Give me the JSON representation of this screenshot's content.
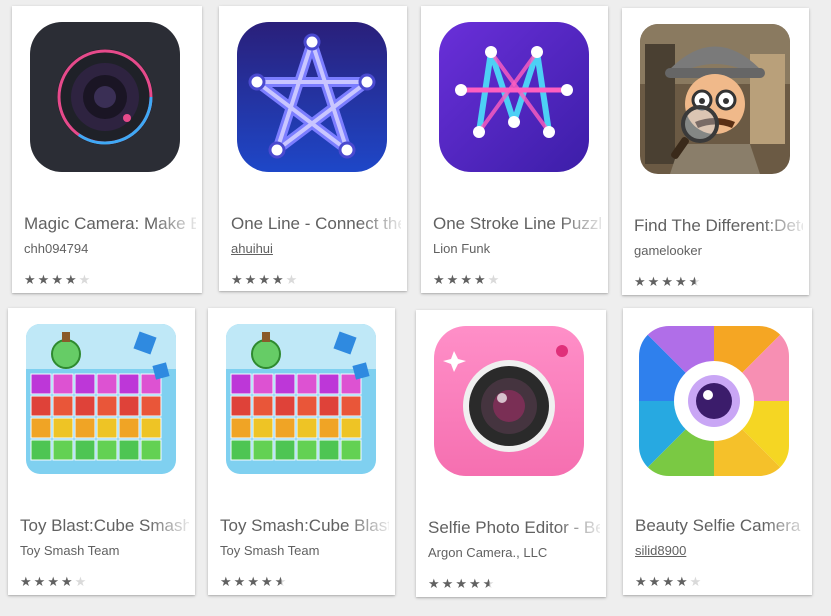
{
  "apps": [
    {
      "title": "Magic Camera: Make Beauty Photos",
      "developer": "chh094794",
      "developer_link": false,
      "rating": 4,
      "icon": "magic-camera-lens-icon"
    },
    {
      "title": "One Line - Connect the Dots",
      "developer": "ahuihui",
      "developer_link": true,
      "rating": 4,
      "icon": "one-line-star-icon"
    },
    {
      "title": "One Stroke Line Puzzle",
      "developer": "Lion Funk",
      "developer_link": false,
      "rating": 4,
      "icon": "one-stroke-letter-m-icon"
    },
    {
      "title": "Find The Different:Detective",
      "developer": "gamelooker",
      "developer_link": false,
      "rating": 4.5,
      "icon": "detective-magnifier-icon"
    },
    {
      "title": "Toy Blast:Cube Smash",
      "developer": "Toy Smash Team",
      "developer_link": false,
      "rating": 4,
      "icon": "toy-blast-cubes-icon"
    },
    {
      "title": "Toy Smash:Cube Blast",
      "developer": "Toy Smash Team",
      "developer_link": false,
      "rating": 4.5,
      "icon": "toy-smash-cubes-icon"
    },
    {
      "title": "Selfie Photo Editor - Beauty Camera",
      "developer": "Argon Camera., LLC",
      "developer_link": false,
      "rating": 4.5,
      "icon": "pink-selfie-camera-icon"
    },
    {
      "title": "Beauty Selfie Camera",
      "developer": "silid8900",
      "developer_link": true,
      "rating": 4,
      "icon": "rainbow-aperture-camera-icon"
    }
  ]
}
